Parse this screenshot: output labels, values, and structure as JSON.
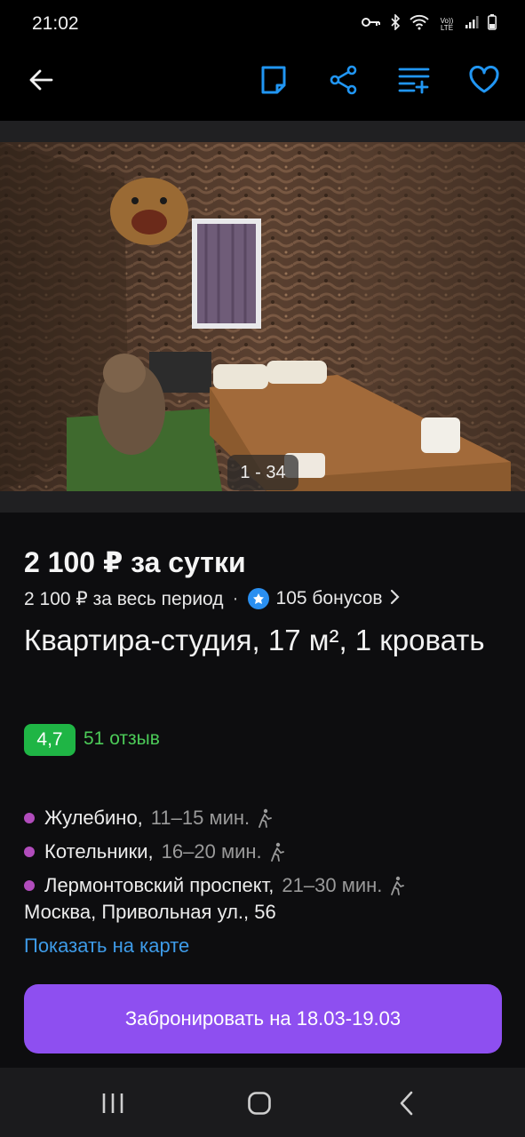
{
  "status_bar": {
    "time": "21:02",
    "icons": [
      "key-icon",
      "bluetooth-icon",
      "wifi-icon",
      "volte-icon",
      "signal-icon",
      "battery-icon"
    ],
    "volte_text": "Vo)) LTE"
  },
  "toolbar": {
    "icons": [
      "back-arrow-icon",
      "note-icon",
      "share-icon",
      "compare-list-icon",
      "heart-icon"
    ],
    "accent_color": "#2196f3"
  },
  "gallery": {
    "counter": "1 - 34"
  },
  "listing": {
    "price_per_day": "2 100 ₽ за сутки",
    "price_total": "2 100 ₽ за весь период",
    "separator": "·",
    "bonus": "105 бонусов",
    "title": "Квартира-студия, 17 м², 1 кровать",
    "rating": "4,7",
    "reviews": "51 отзыв",
    "metro": [
      {
        "name": "Жулебино,",
        "time": "11–15 мин."
      },
      {
        "name": "Котельники,",
        "time": "16–20 мин."
      },
      {
        "name": "Лермонтовский проспект,",
        "time": "21–30 мин."
      }
    ],
    "metro_color": "#b14cbc",
    "address": "Москва, Привольная ул., 56",
    "map_link": "Показать на карте"
  },
  "book_button": {
    "label": "Забронировать на 18.03-19.03",
    "color": "#8e4ff0"
  },
  "nav_bar": {
    "icons": [
      "recent-apps-icon",
      "home-icon",
      "back-icon"
    ]
  }
}
